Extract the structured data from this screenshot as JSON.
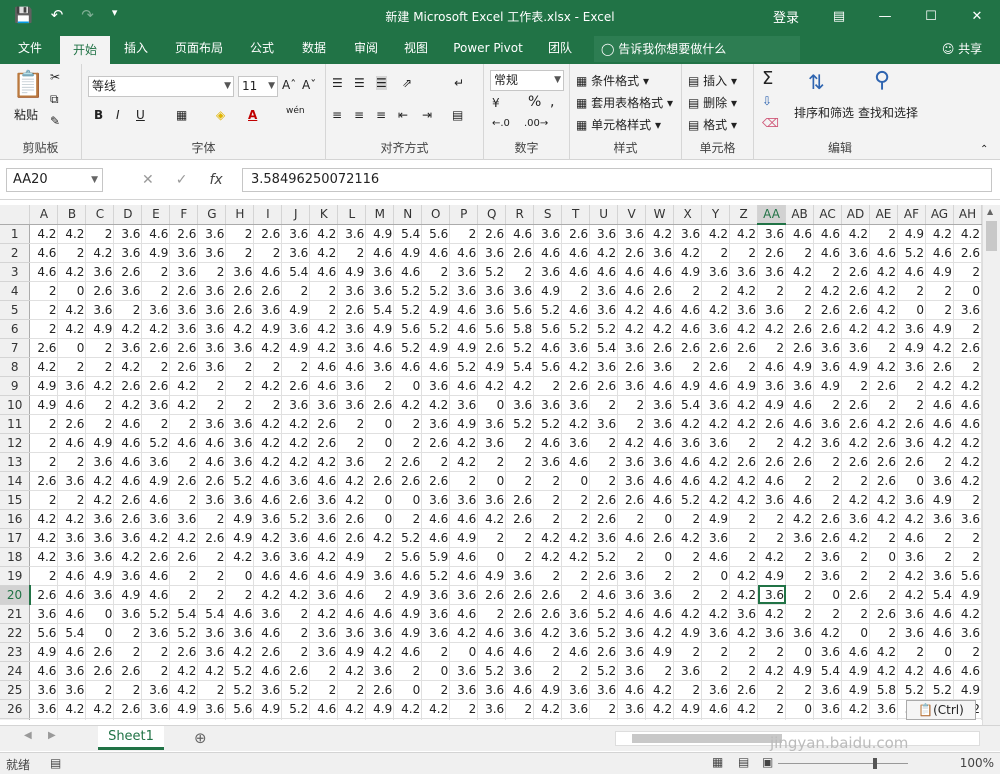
{
  "app": {
    "title": "新建 Microsoft Excel 工作表.xlsx - Excel",
    "login": "登录",
    "window_controls": [
      "ribbon-display-icon",
      "minimize-icon",
      "restore-icon",
      "close-icon"
    ]
  },
  "qat": {
    "save": "save-icon",
    "undo": "undo-icon",
    "redo": "redo-icon",
    "customize": "customize-icon"
  },
  "tabs": [
    "文件",
    "开始",
    "插入",
    "页面布局",
    "公式",
    "数据",
    "审阅",
    "视图",
    "Power Pivot",
    "团队"
  ],
  "active_tab": "开始",
  "tellme": "告诉我你想要做什么",
  "share": "共享",
  "ribbon": {
    "clipboard": {
      "paste": "粘贴",
      "label": "剪贴板"
    },
    "font": {
      "name": "等线",
      "size": "11",
      "bold": "B",
      "italic": "I",
      "underline": "U",
      "label": "字体",
      "wen": "wén",
      "fontcolor": "A"
    },
    "alignment": {
      "label": "对齐方式"
    },
    "number": {
      "format": "常规",
      "percent": "%",
      "comma": ",",
      "label": "数字"
    },
    "styles": {
      "cond": "条件格式",
      "table": "套用表格格式",
      "cell": "单元格样式",
      "label": "样式"
    },
    "cells": {
      "insert": "插入",
      "delete": "删除",
      "format": "格式",
      "label": "单元格"
    },
    "editing": {
      "sort": "排序和筛选",
      "find": "查找和选择",
      "label": "编辑"
    }
  },
  "formula": {
    "namebox": "AA20",
    "fx": "fx",
    "value": "3.58496250072116"
  },
  "columns": [
    "A",
    "B",
    "C",
    "D",
    "E",
    "F",
    "G",
    "H",
    "I",
    "J",
    "K",
    "L",
    "M",
    "N",
    "O",
    "P",
    "Q",
    "R",
    "S",
    "T",
    "U",
    "V",
    "W",
    "X",
    "Y",
    "Z",
    "AA",
    "AB",
    "AC",
    "AD",
    "AE",
    "AF",
    "AG",
    "AH"
  ],
  "selected": {
    "row": 20,
    "col": "AA"
  },
  "rows": [
    [
      "4.2",
      "4.2",
      "2",
      "3.6",
      "4.6",
      "2.6",
      "3.6",
      "2",
      "2.6",
      "3.6",
      "4.2",
      "3.6",
      "4.9",
      "5.4",
      "5.6",
      "2",
      "2.6",
      "4.6",
      "3.6",
      "2.6",
      "3.6",
      "3.6",
      "4.2",
      "3.6",
      "4.2",
      "4.2",
      "3.6",
      "4.6",
      "4.6",
      "4.2",
      "2",
      "4.9",
      "4.2",
      "4.2"
    ],
    [
      "4.6",
      "2",
      "4.2",
      "3.6",
      "4.9",
      "3.6",
      "3.6",
      "2",
      "2",
      "3.6",
      "4.2",
      "2",
      "4.6",
      "4.9",
      "4.6",
      "4.6",
      "3.6",
      "2.6",
      "4.6",
      "4.6",
      "4.2",
      "2.6",
      "3.6",
      "4.2",
      "2",
      "2",
      "2.6",
      "2",
      "4.6",
      "3.6",
      "4.6",
      "5.2",
      "4.6",
      "2.6"
    ],
    [
      "4.6",
      "4.2",
      "3.6",
      "2.6",
      "2",
      "3.6",
      "2",
      "3.6",
      "4.6",
      "5.4",
      "4.6",
      "4.9",
      "3.6",
      "4.6",
      "2",
      "3.6",
      "5.2",
      "2",
      "3.6",
      "4.6",
      "4.6",
      "4.6",
      "4.6",
      "4.9",
      "3.6",
      "3.6",
      "3.6",
      "4.2",
      "2",
      "2.6",
      "4.2",
      "4.6",
      "4.9",
      "2"
    ],
    [
      "2",
      "0",
      "2.6",
      "3.6",
      "2",
      "2.6",
      "3.6",
      "2.6",
      "2.6",
      "2",
      "2",
      "3.6",
      "3.6",
      "5.2",
      "5.2",
      "3.6",
      "3.6",
      "3.6",
      "4.9",
      "2",
      "3.6",
      "4.6",
      "2.6",
      "2",
      "2",
      "4.2",
      "2",
      "2",
      "4.2",
      "2.6",
      "4.2",
      "2",
      "2",
      "0"
    ],
    [
      "2",
      "4.2",
      "3.6",
      "2",
      "3.6",
      "3.6",
      "3.6",
      "2.6",
      "3.6",
      "4.9",
      "2",
      "2.6",
      "5.4",
      "5.2",
      "4.9",
      "4.6",
      "3.6",
      "5.6",
      "5.2",
      "4.6",
      "3.6",
      "4.2",
      "4.6",
      "4.6",
      "4.2",
      "3.6",
      "3.6",
      "2",
      "2.6",
      "2.6",
      "4.2",
      "0",
      "2",
      "3.6"
    ],
    [
      "2",
      "4.2",
      "4.9",
      "4.2",
      "4.2",
      "3.6",
      "3.6",
      "4.2",
      "4.9",
      "3.6",
      "4.2",
      "3.6",
      "4.9",
      "5.6",
      "5.2",
      "4.6",
      "5.6",
      "5.8",
      "5.6",
      "5.2",
      "5.2",
      "4.2",
      "4.2",
      "4.6",
      "3.6",
      "4.2",
      "4.2",
      "2.6",
      "2.6",
      "4.2",
      "4.2",
      "3.6",
      "4.9",
      "2"
    ],
    [
      "2.6",
      "0",
      "2",
      "3.6",
      "2.6",
      "2.6",
      "3.6",
      "3.6",
      "4.2",
      "4.9",
      "4.2",
      "3.6",
      "4.6",
      "5.2",
      "4.9",
      "4.9",
      "2.6",
      "5.2",
      "4.6",
      "3.6",
      "5.4",
      "3.6",
      "2.6",
      "2.6",
      "2.6",
      "2.6",
      "2",
      "2.6",
      "3.6",
      "3.6",
      "2",
      "4.9",
      "4.2",
      "2.6"
    ],
    [
      "4.2",
      "2",
      "2",
      "4.2",
      "2",
      "2.6",
      "3.6",
      "2",
      "2",
      "2",
      "4.6",
      "4.6",
      "3.6",
      "4.6",
      "4.6",
      "5.2",
      "4.9",
      "5.4",
      "5.6",
      "4.2",
      "3.6",
      "2.6",
      "3.6",
      "2",
      "2.6",
      "2",
      "4.6",
      "4.9",
      "3.6",
      "4.9",
      "4.2",
      "3.6",
      "2.6",
      "2"
    ],
    [
      "4.9",
      "3.6",
      "4.2",
      "2.6",
      "2.6",
      "4.2",
      "2",
      "2",
      "4.2",
      "2.6",
      "4.6",
      "3.6",
      "2",
      "0",
      "3.6",
      "4.6",
      "4.2",
      "4.2",
      "2",
      "2.6",
      "2.6",
      "3.6",
      "4.6",
      "4.9",
      "4.6",
      "4.9",
      "3.6",
      "3.6",
      "4.9",
      "2",
      "2.6",
      "2",
      "4.2",
      "4.2"
    ],
    [
      "4.9",
      "4.6",
      "2",
      "4.2",
      "3.6",
      "4.2",
      "2",
      "2",
      "2",
      "3.6",
      "3.6",
      "3.6",
      "2.6",
      "4.2",
      "4.2",
      "3.6",
      "0",
      "3.6",
      "3.6",
      "3.6",
      "2",
      "2",
      "3.6",
      "5.4",
      "3.6",
      "4.2",
      "4.9",
      "4.6",
      "2",
      "2.6",
      "2",
      "2",
      "4.6",
      "4.6"
    ],
    [
      "2",
      "2.6",
      "2",
      "4.6",
      "2",
      "2",
      "3.6",
      "3.6",
      "4.2",
      "4.2",
      "2.6",
      "2",
      "0",
      "2",
      "3.6",
      "4.9",
      "3.6",
      "5.2",
      "5.2",
      "4.2",
      "3.6",
      "2",
      "3.6",
      "4.2",
      "4.2",
      "4.2",
      "2.6",
      "4.6",
      "3.6",
      "2.6",
      "4.2",
      "2.6",
      "4.6",
      "4.6"
    ],
    [
      "2",
      "4.6",
      "4.9",
      "4.6",
      "5.2",
      "4.6",
      "4.6",
      "3.6",
      "4.2",
      "4.2",
      "2.6",
      "2",
      "0",
      "2",
      "2.6",
      "4.2",
      "3.6",
      "2",
      "4.6",
      "3.6",
      "2",
      "4.2",
      "4.6",
      "3.6",
      "3.6",
      "2",
      "2",
      "4.2",
      "3.6",
      "4.2",
      "2.6",
      "3.6",
      "4.2",
      "4.2"
    ],
    [
      "2",
      "2",
      "3.6",
      "4.6",
      "3.6",
      "2",
      "4.6",
      "3.6",
      "4.2",
      "4.2",
      "4.2",
      "3.6",
      "2",
      "2.6",
      "2",
      "4.2",
      "2",
      "2",
      "3.6",
      "4.6",
      "2",
      "3.6",
      "3.6",
      "4.6",
      "4.2",
      "2.6",
      "2.6",
      "2.6",
      "2",
      "2.6",
      "2.6",
      "2.6",
      "2",
      "4.2"
    ],
    [
      "2.6",
      "3.6",
      "4.2",
      "4.6",
      "4.9",
      "2.6",
      "2.6",
      "5.2",
      "4.6",
      "3.6",
      "4.6",
      "4.2",
      "2.6",
      "2.6",
      "2.6",
      "2",
      "0",
      "2",
      "2",
      "0",
      "2",
      "3.6",
      "4.6",
      "4.6",
      "4.2",
      "4.2",
      "4.6",
      "2",
      "2",
      "2",
      "2.6",
      "0",
      "3.6",
      "4.2"
    ],
    [
      "2",
      "2",
      "4.2",
      "2.6",
      "4.6",
      "2",
      "3.6",
      "3.6",
      "4.6",
      "2.6",
      "3.6",
      "4.2",
      "0",
      "0",
      "3.6",
      "3.6",
      "3.6",
      "2.6",
      "2",
      "2",
      "2.6",
      "2.6",
      "4.6",
      "5.2",
      "4.2",
      "4.2",
      "3.6",
      "4.6",
      "2",
      "4.2",
      "4.2",
      "3.6",
      "4.9",
      "2"
    ],
    [
      "4.2",
      "4.2",
      "3.6",
      "2.6",
      "3.6",
      "3.6",
      "2",
      "4.9",
      "3.6",
      "5.2",
      "3.6",
      "2.6",
      "0",
      "2",
      "4.6",
      "4.6",
      "4.2",
      "2.6",
      "2",
      "2",
      "2.6",
      "2",
      "0",
      "2",
      "4.9",
      "2",
      "2",
      "4.2",
      "2.6",
      "3.6",
      "4.2",
      "4.2",
      "3.6",
      "3.6"
    ],
    [
      "4.2",
      "3.6",
      "3.6",
      "3.6",
      "4.2",
      "4.2",
      "2.6",
      "4.9",
      "4.2",
      "3.6",
      "4.6",
      "2.6",
      "4.2",
      "5.2",
      "4.6",
      "4.9",
      "2",
      "2",
      "4.2",
      "4.2",
      "3.6",
      "4.6",
      "2.6",
      "4.2",
      "3.6",
      "2",
      "2",
      "3.6",
      "2.6",
      "4.2",
      "2",
      "4.6",
      "2",
      "2"
    ],
    [
      "4.2",
      "3.6",
      "3.6",
      "4.2",
      "2.6",
      "2.6",
      "2",
      "4.2",
      "3.6",
      "3.6",
      "4.2",
      "4.9",
      "2",
      "5.6",
      "5.9",
      "4.6",
      "0",
      "2",
      "4.2",
      "4.2",
      "5.2",
      "2",
      "0",
      "2",
      "4.6",
      "2",
      "4.2",
      "2",
      "3.6",
      "2",
      "0",
      "3.6",
      "2",
      "2"
    ],
    [
      "2",
      "4.6",
      "4.9",
      "3.6",
      "4.6",
      "2",
      "2",
      "0",
      "4.6",
      "4.6",
      "4.6",
      "4.9",
      "3.6",
      "4.6",
      "5.2",
      "4.6",
      "4.9",
      "3.6",
      "2",
      "2",
      "2.6",
      "3.6",
      "2",
      "2",
      "0",
      "4.2",
      "4.9",
      "2",
      "3.6",
      "2",
      "2",
      "4.2",
      "3.6",
      "5.6"
    ],
    [
      "2.6",
      "4.6",
      "3.6",
      "4.9",
      "4.6",
      "2",
      "2",
      "2",
      "4.2",
      "4.2",
      "3.6",
      "4.6",
      "2",
      "4.9",
      "3.6",
      "3.6",
      "2.6",
      "2.6",
      "2.6",
      "2",
      "4.6",
      "3.6",
      "3.6",
      "2",
      "2",
      "4.2",
      "3.6",
      "2",
      "0",
      "2.6",
      "2",
      "4.2",
      "5.4",
      "4.9"
    ],
    [
      "3.6",
      "4.6",
      "0",
      "3.6",
      "5.2",
      "5.4",
      "5.4",
      "4.6",
      "3.6",
      "2",
      "4.2",
      "4.6",
      "4.6",
      "4.9",
      "3.6",
      "4.6",
      "2",
      "2.6",
      "2.6",
      "3.6",
      "5.2",
      "4.6",
      "4.6",
      "4.2",
      "4.2",
      "3.6",
      "4.2",
      "2",
      "2",
      "2",
      "2.6",
      "3.6",
      "4.6",
      "4.2"
    ],
    [
      "5.6",
      "5.4",
      "0",
      "2",
      "3.6",
      "5.2",
      "3.6",
      "3.6",
      "4.6",
      "2",
      "3.6",
      "3.6",
      "3.6",
      "4.9",
      "3.6",
      "4.2",
      "4.6",
      "3.6",
      "4.2",
      "3.6",
      "5.2",
      "3.6",
      "4.2",
      "4.9",
      "3.6",
      "4.2",
      "3.6",
      "3.6",
      "4.2",
      "0",
      "2",
      "3.6",
      "4.6",
      "3.6"
    ],
    [
      "4.9",
      "4.6",
      "2.6",
      "2",
      "2",
      "2.6",
      "3.6",
      "4.2",
      "2.6",
      "2",
      "3.6",
      "4.9",
      "4.2",
      "4.6",
      "2",
      "0",
      "4.6",
      "4.6",
      "2",
      "4.6",
      "2.6",
      "3.6",
      "4.9",
      "2",
      "2",
      "2",
      "2",
      "0",
      "3.6",
      "4.6",
      "4.2",
      "2",
      "0",
      "2"
    ],
    [
      "4.6",
      "3.6",
      "2.6",
      "2.6",
      "2",
      "4.2",
      "4.2",
      "5.2",
      "4.6",
      "2.6",
      "2",
      "4.2",
      "3.6",
      "2",
      "0",
      "3.6",
      "5.2",
      "3.6",
      "2",
      "2",
      "5.2",
      "3.6",
      "2",
      "3.6",
      "2",
      "2",
      "4.2",
      "4.9",
      "5.4",
      "4.9",
      "4.2",
      "4.2",
      "4.6",
      "4.6"
    ],
    [
      "3.6",
      "3.6",
      "2",
      "2",
      "3.6",
      "4.2",
      "2",
      "5.2",
      "3.6",
      "5.2",
      "2",
      "2",
      "2.6",
      "0",
      "2",
      "3.6",
      "3.6",
      "4.6",
      "4.9",
      "3.6",
      "3.6",
      "4.6",
      "4.2",
      "2",
      "3.6",
      "2.6",
      "2",
      "2",
      "3.6",
      "4.9",
      "5.8",
      "5.2",
      "5.2",
      "4.9"
    ],
    [
      "3.6",
      "4.2",
      "4.2",
      "2.6",
      "3.6",
      "4.9",
      "3.6",
      "5.6",
      "4.9",
      "5.2",
      "4.6",
      "4.2",
      "4.9",
      "4.2",
      "4.2",
      "2",
      "3.6",
      "2",
      "4.2",
      "3.6",
      "2",
      "3.6",
      "4.2",
      "4.9",
      "4.6",
      "4.2",
      "2",
      "0",
      "3.6",
      "4.2",
      "3.6",
      "5.6",
      "4.9",
      "2"
    ],
    [
      "3.6",
      "4.2",
      "4.2",
      "0",
      "2.6",
      "2.6",
      "5.4",
      "5.4",
      "2",
      "3.6",
      "4.9",
      "4.6",
      "3.6",
      "4.2",
      "4.6",
      "3.6",
      "3.6",
      "5.4",
      "5.4",
      "4.9",
      "3.6",
      "2",
      "4.9",
      "3.6",
      "2.6",
      "2",
      "3.6",
      "2",
      "4.9",
      "4.9",
      "4.2",
      "2",
      "4.6",
      "4.2"
    ]
  ],
  "sheet": {
    "name": "Sheet1"
  },
  "ctrl_tag": "(Ctrl)",
  "status": {
    "ready": "就绪",
    "zoom": "100%"
  },
  "watermark": "jingyan.baidu.com"
}
